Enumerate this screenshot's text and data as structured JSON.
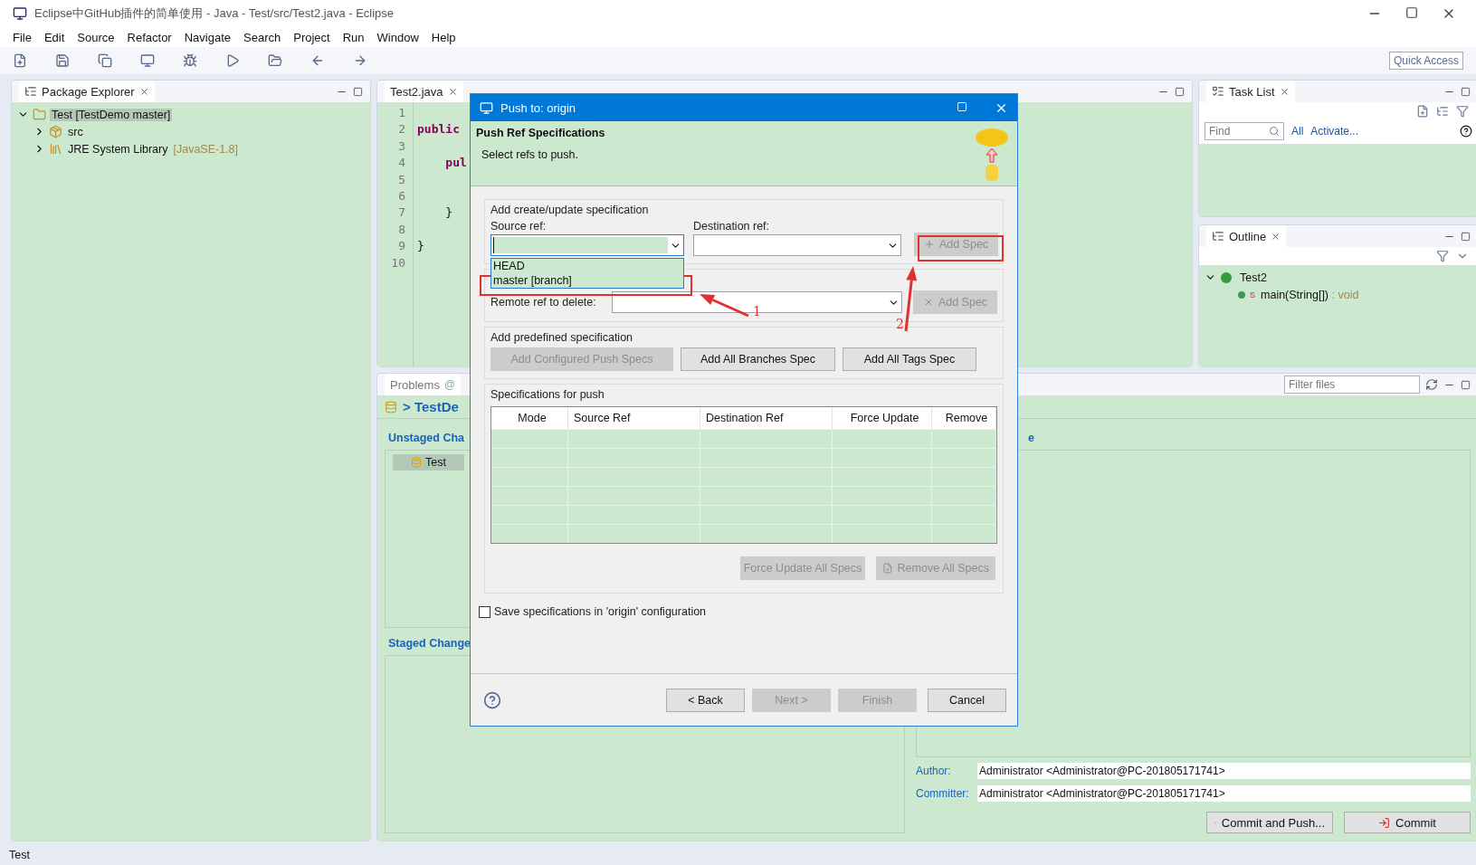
{
  "window": {
    "title": "Eclipse中GitHub插件的简单使用 - Java - Test/src/Test2.java - Eclipse"
  },
  "menu": [
    "File",
    "Edit",
    "Source",
    "Refactor",
    "Navigate",
    "Search",
    "Project",
    "Run",
    "Window",
    "Help"
  ],
  "quick_access": "Quick Access",
  "package_explorer": {
    "title": "Package Explorer",
    "tree": [
      {
        "label": "Test [TestDemo master]",
        "kind": "project",
        "expanded": true,
        "selected": true,
        "children": [
          {
            "label": "src",
            "kind": "folder",
            "expanded": false,
            "selected": false
          },
          {
            "label": "JRE System Library",
            "decoration": "[JavaSE-1.8]",
            "kind": "library",
            "expanded": false,
            "selected": false
          }
        ]
      }
    ]
  },
  "editor": {
    "tab": "Test2.java",
    "lines": [
      {
        "number": "1"
      },
      {
        "number": "2",
        "code": "public",
        "kind": "keyword"
      },
      {
        "number": "3"
      },
      {
        "number": "4",
        "code": "    pul",
        "kind": "keyword"
      },
      {
        "number": "5"
      },
      {
        "number": "6"
      },
      {
        "number": "7",
        "code": "    }",
        "kind": "plain"
      },
      {
        "number": "8"
      },
      {
        "number": "9",
        "code": "}",
        "kind": "plain"
      },
      {
        "number": "10"
      }
    ]
  },
  "task_list": {
    "title": "Task List",
    "find_placeholder": "Find",
    "links": [
      "All",
      "Activate..."
    ]
  },
  "outline": {
    "title": "Outline",
    "tree": [
      {
        "label": "Test2",
        "expanded": true,
        "children": [
          {
            "label": "main(String[])",
            "modifier": "S",
            "type": " : void"
          }
        ]
      }
    ]
  },
  "bottom": {
    "tab": "Problems",
    "tab_fragment": "@",
    "filter_placeholder": "Filter files",
    "repository": "> TestDe",
    "unstaged_title": "Unstaged Cha",
    "unstaged_items": [
      "Test"
    ],
    "staged_title": "Staged Change",
    "message_title": "e",
    "author_label": "Author:",
    "author": "Administrator <Administrator@PC-201805171741>",
    "committer_label": "Committer:",
    "committer": "Administrator <Administrator@PC-201805171741>",
    "buttons": [
      "Commit and Push...",
      "Commit"
    ]
  },
  "status_bar": "Test",
  "dialog": {
    "title": "Push to: origin",
    "heading": "Push Ref Specifications",
    "description": "Select refs to push.",
    "create_group": {
      "title": "Add create/update specification",
      "source_label": "Source ref:",
      "destination_label": "Destination ref:",
      "source_options": [
        "HEAD",
        "master [branch]"
      ],
      "add_button": {
        "label": "Add Spec",
        "disabled": true
      }
    },
    "delete_group": {
      "label": "Remote ref to delete:",
      "add_button": {
        "label": "Add Spec",
        "disabled": true
      }
    },
    "predefined_group": {
      "title": "Add predefined specification",
      "buttons": [
        {
          "label": "Add Configured Push Specs",
          "disabled": true
        },
        {
          "label": "Add All Branches Spec",
          "disabled": false
        },
        {
          "label": "Add All Tags Spec",
          "disabled": false
        }
      ]
    },
    "specs_group": {
      "title": "Specifications for push",
      "columns": [
        "Mode",
        "Source Ref",
        "Destination Ref",
        "Force Update",
        "Remove"
      ],
      "buttons": [
        {
          "label": "Force Update All Specs",
          "disabled": true
        },
        {
          "label": "Remove All Specs",
          "disabled": true
        }
      ]
    },
    "save_checkbox": {
      "label": "Save specifications in 'origin' configuration",
      "checked": false
    },
    "buttons": [
      {
        "label": "< Back",
        "disabled": false
      },
      {
        "label": "Next >",
        "disabled": true
      },
      {
        "label": "Finish",
        "disabled": true
      },
      {
        "label": "Cancel",
        "disabled": false
      }
    ]
  },
  "annotations": [
    {
      "label": "1"
    },
    {
      "label": "2"
    }
  ]
}
